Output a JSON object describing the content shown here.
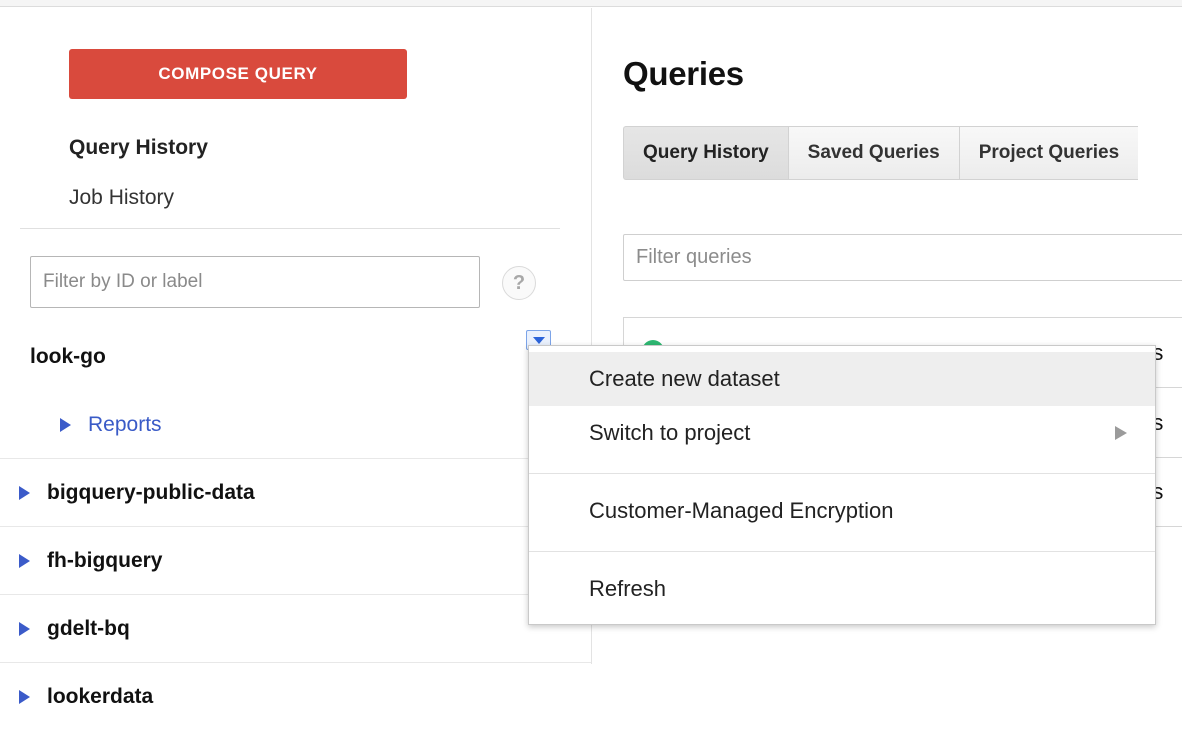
{
  "sidebar": {
    "compose_button": "COMPOSE QUERY",
    "nav": [
      {
        "label": "Query History",
        "active": true
      },
      {
        "label": "Job History",
        "active": false
      }
    ],
    "filter": {
      "placeholder": "Filter by ID or label",
      "value": ""
    },
    "help_icon": "?",
    "tree": [
      {
        "label": "look-go",
        "level": "project",
        "caret": false,
        "bold": true,
        "link": false,
        "divider": false
      },
      {
        "label": "Reports",
        "level": "child",
        "caret": true,
        "bold": false,
        "link": true,
        "divider": true
      },
      {
        "label": "bigquery-public-data",
        "level": "project-caret",
        "caret": true,
        "bold": true,
        "link": false,
        "divider": true
      },
      {
        "label": "fh-bigquery",
        "level": "project-caret",
        "caret": true,
        "bold": true,
        "link": false,
        "divider": true
      },
      {
        "label": "gdelt-bq",
        "level": "project-caret",
        "caret": true,
        "bold": true,
        "link": false,
        "divider": true
      },
      {
        "label": "lookerdata",
        "level": "project-caret",
        "caret": true,
        "bold": true,
        "link": false,
        "divider": false
      }
    ]
  },
  "main": {
    "title": "Queries",
    "tabs": [
      {
        "label": "Query History",
        "active": true
      },
      {
        "label": "Saved Queries",
        "active": false
      },
      {
        "label": "Project Queries",
        "active": false
      }
    ],
    "filter": {
      "placeholder": "Filter queries",
      "value": ""
    },
    "results": [
      {
        "status": "success",
        "text": "nts"
      },
      {
        "status": "success",
        "text": "nts"
      },
      {
        "status": "success",
        "text": "nts"
      }
    ]
  },
  "context_menu": {
    "items": [
      {
        "label": "Create new dataset",
        "highlighted": true,
        "submenu": false,
        "separator_after": false
      },
      {
        "label": "Switch to project",
        "highlighted": false,
        "submenu": true,
        "separator_after": true
      },
      {
        "label": "Customer-Managed Encryption",
        "highlighted": false,
        "submenu": false,
        "separator_after": true
      },
      {
        "label": "Refresh",
        "highlighted": false,
        "submenu": false,
        "separator_after": false
      }
    ]
  },
  "colors": {
    "accent_red": "#d94a3d",
    "link_blue": "#3a5bc7",
    "caret_blue": "#3b5bc9",
    "status_green": "#2eb872",
    "menu_highlight": "#eeeeee"
  }
}
